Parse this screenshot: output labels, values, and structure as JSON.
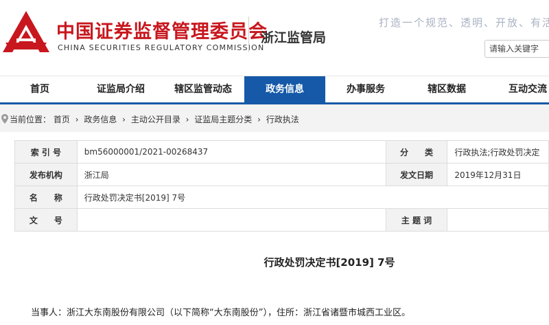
{
  "header": {
    "cn_name": "中国证券监督管理委员会",
    "en_name": "CHINA SECURITIES REGULATORY COMMISSION",
    "bureau": "浙江监管局",
    "slogan": "打造一个规范、透明、开放、有活力",
    "search_placeholder": "请输入关键字",
    "brand_color": "#c8171e"
  },
  "nav": {
    "accent_color": "#1559a8",
    "active_index": 3,
    "items": [
      {
        "label": "首页"
      },
      {
        "label": "证监局介绍"
      },
      {
        "label": "辖区监管动态"
      },
      {
        "label": "政务信息"
      },
      {
        "label": "办事服务"
      },
      {
        "label": "辖区数据"
      },
      {
        "label": "互动交流"
      }
    ]
  },
  "breadcrumb": {
    "prefix": "当前位置：",
    "separator": "›",
    "items": [
      "首页",
      "政务信息",
      "主动公开目录",
      "证监局主题分类",
      "行政执法"
    ]
  },
  "info": {
    "index_label": "索 引 号",
    "index_value": "bm56000001/2021-00268437",
    "category_label": "分　　类",
    "category_value": "行政执法;行政处罚决定",
    "agency_label": "发布机构",
    "agency_value": "浙江局",
    "date_label": "发文日期",
    "date_value": "2019年12月31日",
    "name_label": "名　　称",
    "name_value": "行政处罚决定书[2019] 7号",
    "docno_label": "文　　号",
    "docno_value": "",
    "subject_label": "主 题 词",
    "subject_value": ""
  },
  "content": {
    "title": "行政处罚决定书[2019] 7号",
    "paragraph": "当事人：浙江大东南股份有限公司（以下简称“大东南股份”），住所：浙江省诸暨市城西工业区。"
  }
}
